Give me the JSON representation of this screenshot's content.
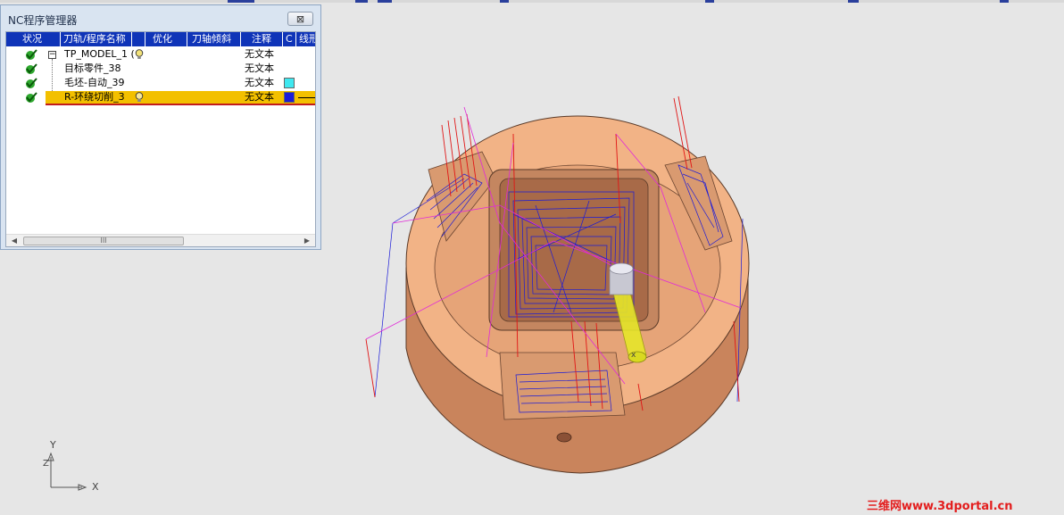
{
  "window": {
    "title": "NC程序管理器",
    "close_label": "⊠"
  },
  "columns": [
    {
      "label": "状况"
    },
    {
      "label": "刀轨/程序名称"
    },
    {
      "label": "优化"
    },
    {
      "label": "刀轴倾斜"
    },
    {
      "label": "注释"
    },
    {
      "label": "C"
    },
    {
      "label": "线形"
    }
  ],
  "rows": [
    {
      "name": "TP_MODEL_1 (",
      "comment": "无文本",
      "color": "",
      "selected": false,
      "expanded": true
    },
    {
      "name": "目标零件_38",
      "comment": "无文本",
      "color": "",
      "selected": false
    },
    {
      "name": "毛坯-自动_39",
      "comment": "无文本",
      "color": "#3fe8f0",
      "selected": false
    },
    {
      "name": "R-环绕切削_3",
      "comment": "无文本",
      "color": "#1c1cd8",
      "selected": true
    }
  ],
  "scrollbar": {
    "thumb_label": "III"
  },
  "axis": {
    "y": "Y",
    "z": "Z",
    "x": "X"
  },
  "watermark": "三维网www.3dportal.cn",
  "colors": {
    "title_bar": "#0f34b8",
    "selected_row": "#f3c000",
    "toolpath": "#1a1ad8",
    "part": "#f2b386"
  }
}
